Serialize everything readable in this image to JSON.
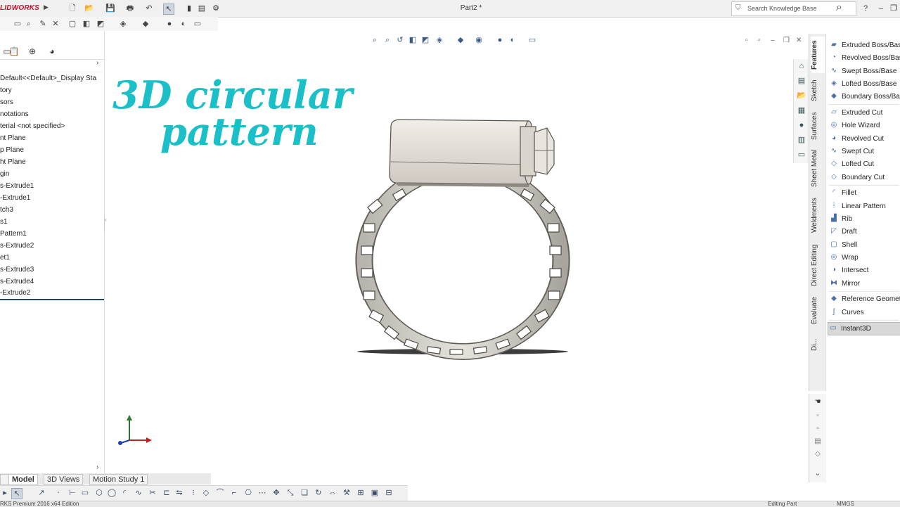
{
  "app": {
    "logo_text": "LIDWORKS",
    "document_title": "Part2 *"
  },
  "search": {
    "placeholder": "Search Knowledge Base"
  },
  "left_panel": {
    "tree_items": [
      "Default<<Default>_Display Sta",
      "tory",
      "sors",
      "notations",
      "terial <not specified>",
      "nt Plane",
      "p Plane",
      "ht Plane",
      "gin",
      "s-Extrude1",
      "-Extrude1",
      "tch3",
      "s1",
      "Pattern1",
      "s-Extrude2",
      "et1",
      "s-Extrude3",
      "s-Extrude4",
      "-Extrude2"
    ]
  },
  "bottom_tabs": [
    "Model",
    "3D Views",
    "Motion Study 1"
  ],
  "status": {
    "left": "RKS Premium 2016 x64 Edition",
    "right1": "Editing Part",
    "right2": "MMGS"
  },
  "overlay": {
    "line1": "3D circular",
    "line2": "pattern"
  },
  "command_tabs": [
    "Features",
    "Sketch",
    "Surfaces",
    "Sheet Metal",
    "Weldments",
    "Direct Editing",
    "Evaluate",
    "Di..."
  ],
  "features": [
    "Extruded Boss/Base",
    "Revolved Boss/Base",
    "Swept Boss/Base",
    "Lofted Boss/Base",
    "Boundary Boss/Base",
    "Extruded Cut",
    "Hole Wizard",
    "Revolved Cut",
    "Swept Cut",
    "Lofted Cut",
    "Boundary Cut",
    "Fillet",
    "Linear Pattern",
    "Rib",
    "Draft",
    "Shell",
    "Wrap",
    "Intersect",
    "Mirror",
    "Reference Geometry",
    "Curves",
    "Instant3D"
  ],
  "colors": {
    "overlay_title": "#1bbfc7",
    "logo": "#c8102e",
    "rollback_bar": "#1f3f77"
  }
}
